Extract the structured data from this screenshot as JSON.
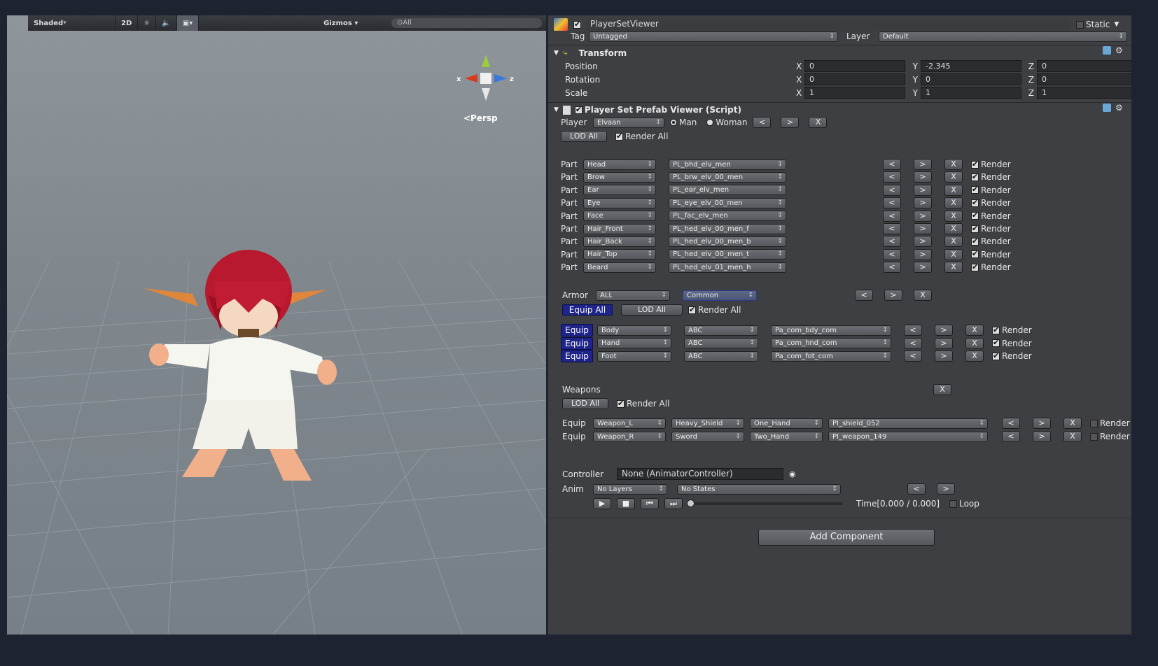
{
  "scene": {
    "shading": "Shaded",
    "mode_2d": "2D",
    "gizmos": "Gizmos",
    "search": "⊙All",
    "persp": "<Persp",
    "axis_x": "x",
    "axis_z": "z"
  },
  "object": {
    "name": "PlayerSetViewer",
    "static_label": "Static",
    "tag_label": "Tag",
    "tag_value": "Untagged",
    "layer_label": "Layer",
    "layer_value": "Default"
  },
  "transform": {
    "title": "Transform",
    "rows": [
      {
        "label": "Position",
        "x": "0",
        "y": "-2.345",
        "z": "0"
      },
      {
        "label": "Rotation",
        "x": "0",
        "y": "0",
        "z": "0"
      },
      {
        "label": "Scale",
        "x": "1",
        "y": "1",
        "z": "1"
      }
    ],
    "x_label": "X",
    "y_label": "Y",
    "z_label": "Z"
  },
  "script": {
    "title": "Player Set Prefab Viewer (Script)",
    "player_label": "Player",
    "player_value": "Elvaan",
    "man": "Man",
    "woman": "Woman",
    "prev": "<",
    "next": ">",
    "clear": "X",
    "lod_all": "LOD All",
    "render_all": "Render All",
    "render": "Render",
    "part_label": "Part",
    "parts": [
      {
        "slot": "Head",
        "asset": "PL_bhd_elv_men"
      },
      {
        "slot": "Brow",
        "asset": "PL_brw_elv_00_men"
      },
      {
        "slot": "Ear",
        "asset": "PL_ear_elv_men"
      },
      {
        "slot": "Eye",
        "asset": "PL_eye_elv_00_men"
      },
      {
        "slot": "Face",
        "asset": "PL_fac_elv_men"
      },
      {
        "slot": "Hair_Front",
        "asset": "PL_hed_elv_00_men_f"
      },
      {
        "slot": "Hair_Back",
        "asset": "PL_hed_elv_00_men_b"
      },
      {
        "slot": "Hair_Top",
        "asset": "PL_hed_elv_00_men_t"
      },
      {
        "slot": "Beard",
        "asset": "PL_hed_elv_01_men_h"
      }
    ],
    "armor_label": "Armor",
    "armor_filter": "ALL",
    "armor_set": "Common",
    "equip_all": "Equip All",
    "equip": "Equip",
    "armor_items": [
      {
        "slot": "Body",
        "set": "ABC",
        "asset": "Pa_com_bdy_com"
      },
      {
        "slot": "Hand",
        "set": "ABC",
        "asset": "Pa_com_hnd_com"
      },
      {
        "slot": "Foot",
        "set": "ABC",
        "asset": "Pa_com_fot_com"
      }
    ],
    "weapons_label": "Weapons",
    "weapons": [
      {
        "slot": "Weapon_L",
        "kind": "Heavy_Shield",
        "hand": "One_Hand",
        "asset": "PI_shield_052"
      },
      {
        "slot": "Weapon_R",
        "kind": "Sword",
        "hand": "Two_Hand",
        "asset": "PI_weapon_149"
      }
    ],
    "controller_label": "Controller",
    "controller_value": "None (AnimatorController)",
    "anim_label": "Anim",
    "anim_layers": "No Layers",
    "anim_states": "No States",
    "time": "Time[0.000 / 0.000]",
    "loop": "Loop"
  },
  "add_component": "Add Component"
}
